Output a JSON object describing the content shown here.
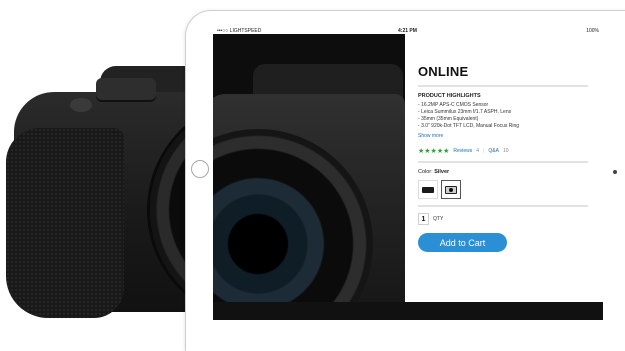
{
  "status_bar": {
    "carrier": "•••○○ LIGHTSPEED",
    "time": "4:21 PM",
    "battery": "100%"
  },
  "product": {
    "title": "ONLINE",
    "highlights_title": "PRODUCT HIGHLIGHTS",
    "highlights": [
      "16.2MP APS-C CMOS Sensor",
      "Leica Summilux 23mm f/1.7 ASPH. Lens",
      "35mm (35mm Equivalent)",
      "3.0\" 920k-Dot TFT LCD, Manual Focus Ring"
    ],
    "show_more": "Show more",
    "rating_stars": "★★★★★",
    "reviews_label": "Reviews",
    "reviews_count": "4",
    "qa_label": "Q&A",
    "qa_count": "10",
    "color_label": "Color:",
    "color_value": "Silver",
    "qty_value": "1",
    "qty_label": "QTY",
    "add_to_cart": "Add to Cart"
  },
  "colors": {
    "accent": "#2b8fd6",
    "stars": "#2d9f3b",
    "link": "#1a6fb5"
  }
}
